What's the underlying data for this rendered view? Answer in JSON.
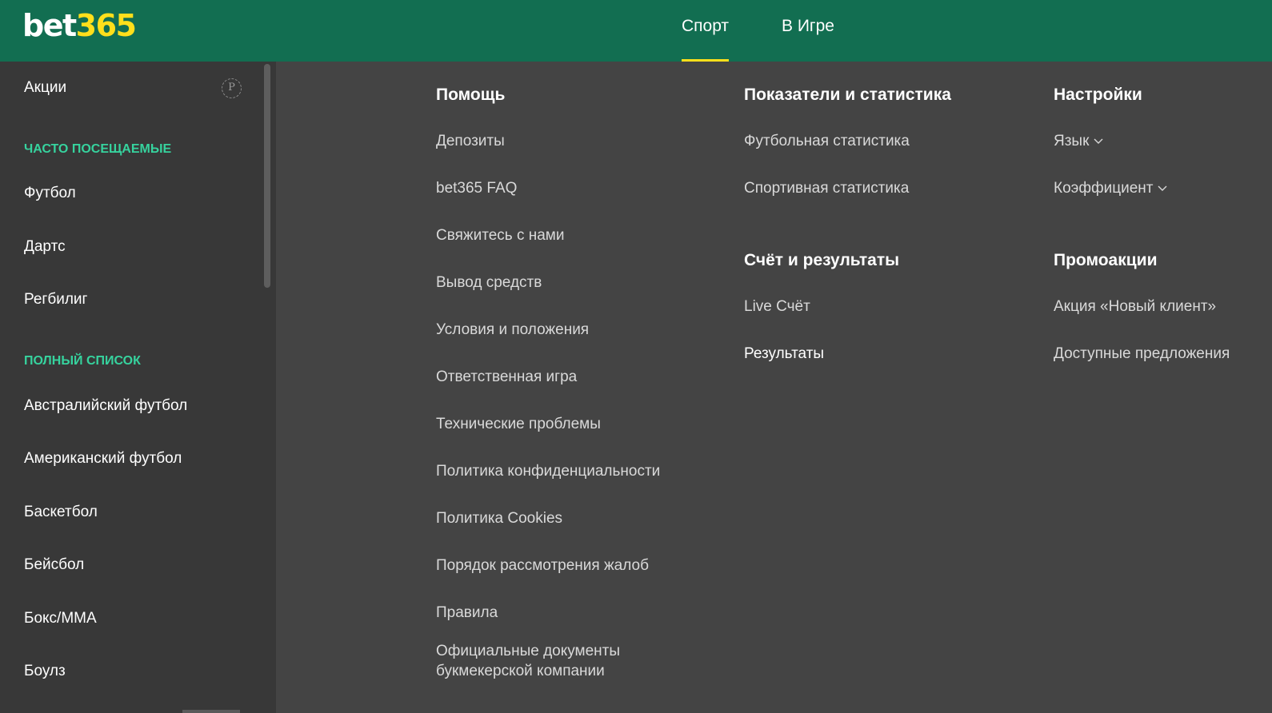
{
  "brand": {
    "logo_part1": "bet",
    "logo_part2": "365"
  },
  "colors": {
    "header_bg": "#126e51",
    "accent_yellow": "#ffdf1b",
    "section_green": "#36d39e"
  },
  "topnav": {
    "tabs": [
      {
        "label": "Спорт",
        "active": true
      },
      {
        "label": "В Игре",
        "active": false
      }
    ]
  },
  "sidebar": {
    "promo": {
      "label": "Акции",
      "icon": "P"
    },
    "frequent_header": "ЧАСТО ПОСЕЩАЕМЫЕ",
    "frequent": [
      "Футбол",
      "Дартс",
      "Регбилиг"
    ],
    "full_header": "ПОЛНЫЙ СПИСОК",
    "full": [
      "Австралийский футбол",
      "Американский футбол",
      "Баскетбол",
      "Бейсбол",
      "Бокс/ММА",
      "Боулз"
    ]
  },
  "menu": {
    "help": {
      "title": "Помощь",
      "links": [
        "Депозиты",
        "bet365 FAQ",
        "Свяжитесь с нами",
        "Вывод средств",
        "Условия и положения",
        "Ответственная игра",
        "Технические проблемы",
        "Политика конфиденциальности",
        "Политика Cookies",
        "Порядок рассмотрения жалоб",
        "Правила",
        "Официальные документы букмекерской компании"
      ]
    },
    "stats": {
      "title": "Показатели и статистика",
      "links": [
        "Футбольная статистика",
        "Спортивная статистика"
      ]
    },
    "scores": {
      "title": "Счёт и результаты",
      "links": [
        "Live Счёт",
        "Результаты"
      ]
    },
    "settings": {
      "title": "Настройки",
      "links": [
        "Язык",
        "Коэффициент"
      ]
    },
    "promos": {
      "title": "Промоакции",
      "links": [
        "Акция «Новый клиент»",
        "Доступные предложения"
      ]
    }
  }
}
